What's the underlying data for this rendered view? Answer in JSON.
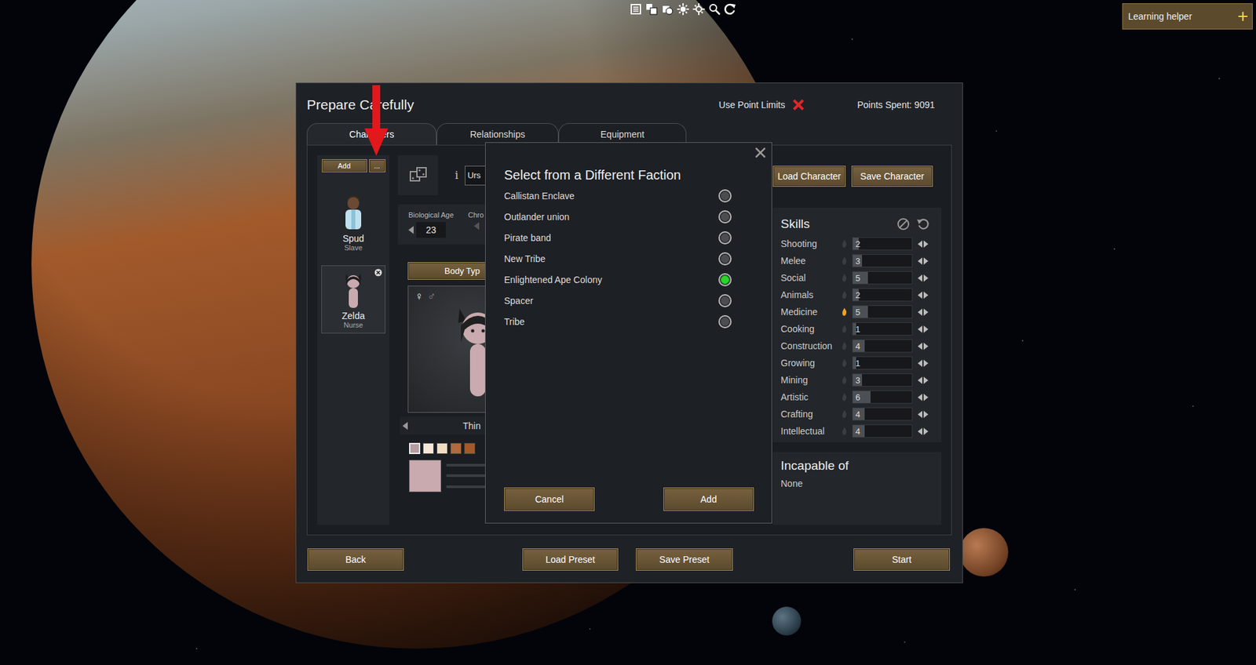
{
  "learning_helper": {
    "label": "Learning helper",
    "icon": "+"
  },
  "dialog": {
    "title": "Prepare Carefully",
    "point_limits": {
      "label": "Use Point Limits",
      "enabled": false
    },
    "points_spent": "Points Spent: 9091",
    "tabs": [
      {
        "label": "Characters",
        "selected": true
      },
      {
        "label": "Relationships",
        "selected": false
      },
      {
        "label": "Equipment",
        "selected": false
      }
    ],
    "character_list": {
      "add_button": "Add",
      "more_button": "...",
      "items": [
        {
          "name": "Spud",
          "role": "Slave",
          "selected": false
        },
        {
          "name": "Zelda",
          "role": "Nurse",
          "selected": true
        }
      ]
    },
    "editor": {
      "info_icon": "i",
      "name_field": "Urs",
      "age_label": "Biological Age",
      "age_value": "23",
      "chrono_label": "Chro",
      "body_type_button": "Body Typ",
      "gender_icons": [
        {
          "label": "♀",
          "selected": true
        },
        {
          "label": "♂",
          "selected": false
        }
      ],
      "body_type": "Thin",
      "skin_swatches": [
        {
          "color": "#b69ba2",
          "selected": true
        },
        {
          "color": "#f6e7d9",
          "selected": false
        },
        {
          "color": "#f1dcc4",
          "selected": false
        },
        {
          "color": "#b2693b",
          "selected": false
        },
        {
          "color": "#a35a2b",
          "selected": false
        }
      ],
      "selected_color": {
        "color": "#c9aaaf"
      }
    },
    "load_character": "Load Character",
    "save_character": "Save Character",
    "skills": {
      "title": "Skills",
      "rows": [
        {
          "name": "Shooting",
          "value": "2",
          "level": 0.1,
          "passion": false
        },
        {
          "name": "Melee",
          "value": "3",
          "level": 0.15,
          "passion": false
        },
        {
          "name": "Social",
          "value": "5",
          "level": 0.25,
          "passion": false
        },
        {
          "name": "Animals",
          "value": "2",
          "level": 0.1,
          "passion": false
        },
        {
          "name": "Medicine",
          "value": "5",
          "level": 0.25,
          "passion": true
        },
        {
          "name": "Cooking",
          "value": "1",
          "level": 0.05,
          "passion": false
        },
        {
          "name": "Construction",
          "value": "4",
          "level": 0.2,
          "passion": false
        },
        {
          "name": "Growing",
          "value": "1",
          "level": 0.05,
          "passion": false
        },
        {
          "name": "Mining",
          "value": "3",
          "level": 0.15,
          "passion": false
        },
        {
          "name": "Artistic",
          "value": "6",
          "level": 0.3,
          "passion": false
        },
        {
          "name": "Crafting",
          "value": "4",
          "level": 0.2,
          "passion": false
        },
        {
          "name": "Intellectual",
          "value": "4",
          "level": 0.2,
          "passion": false
        }
      ]
    },
    "incapable": {
      "title": "Incapable of",
      "value": "None"
    },
    "footer_buttons": [
      "Back",
      "Load Preset",
      "Save Preset",
      "Start"
    ]
  },
  "faction_modal": {
    "title": "Select from a Different Faction",
    "options": [
      {
        "label": "Callistan Enclave",
        "selected": false
      },
      {
        "label": "Outlander union",
        "selected": false
      },
      {
        "label": "Pirate band",
        "selected": false
      },
      {
        "label": "New Tribe",
        "selected": false
      },
      {
        "label": "Enlightened Ape Colony",
        "selected": true
      },
      {
        "label": "Spacer",
        "selected": false
      },
      {
        "label": "Tribe",
        "selected": false
      }
    ],
    "buttons": [
      "Cancel",
      "Add"
    ]
  }
}
